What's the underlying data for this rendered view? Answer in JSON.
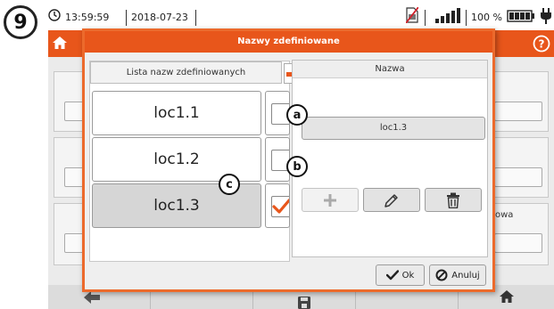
{
  "step_marker": "9",
  "status_bar": {
    "time": "13:59:59",
    "date": "2018-07-23",
    "battery_percent": "100 %",
    "signal_bars": 4
  },
  "background_app": {
    "label_partial": "owa"
  },
  "dialog": {
    "title": "Nazwy zdefiniowane",
    "list_header": "Lista nazw zdefiniowanych",
    "items": [
      {
        "label": "loc1.1",
        "checked": false,
        "selected": false
      },
      {
        "label": "loc1.2",
        "checked": false,
        "selected": false
      },
      {
        "label": "loc1.3",
        "checked": true,
        "selected": true
      }
    ],
    "name_panel_header": "Nazwa",
    "name_value": "loc1.3",
    "ok_label": "Ok",
    "cancel_label": "Anuluj"
  },
  "callouts": {
    "a": "a",
    "b": "b",
    "c": "c"
  },
  "colors": {
    "accent": "#e8561b",
    "dialog_border": "#ec6a2c",
    "check": "#e8561b"
  },
  "icons": [
    "clock-icon",
    "home-icon",
    "help-icon",
    "sim-icon",
    "signal-icon",
    "battery-icon",
    "plug-icon",
    "plus-icon",
    "pencil-icon",
    "trash-icon",
    "check-icon",
    "cancel-icon",
    "save-icon"
  ]
}
